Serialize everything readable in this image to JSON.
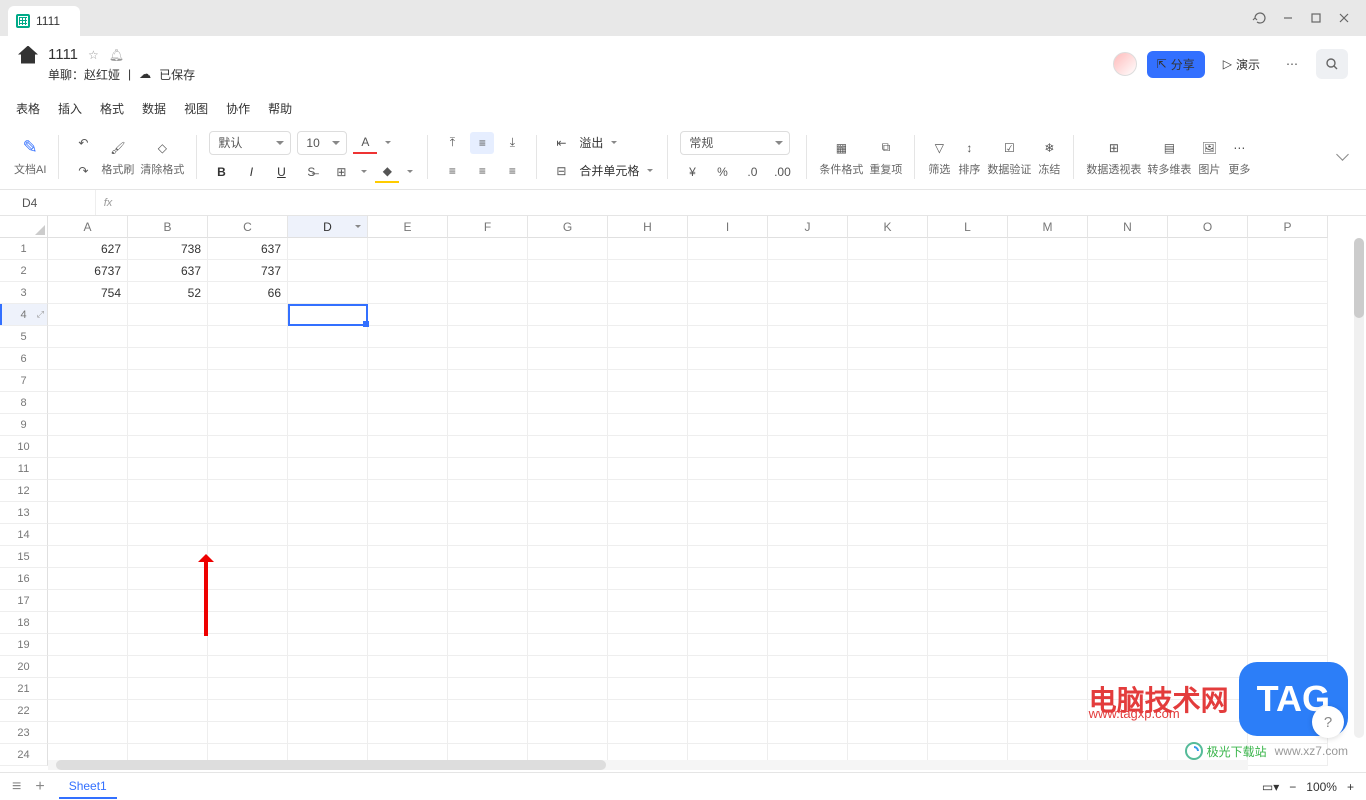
{
  "titlebar": {
    "tab": "1111"
  },
  "header": {
    "title": "1111",
    "author_label": "单聊：",
    "author": "赵红娅",
    "saved_label": "已保存",
    "share": "分享",
    "present": "演示"
  },
  "menu": [
    "表格",
    "插入",
    "格式",
    "数据",
    "视图",
    "协作",
    "帮助"
  ],
  "toolbar": {
    "doc_ai": "文档AI",
    "brush": "格式刷",
    "clear": "清除格式",
    "font": "默认",
    "size": "10",
    "overflow": "溢出",
    "merge": "合并单元格",
    "format": "常规",
    "cond": "条件格式",
    "dup": "重复项",
    "filter": "筛选",
    "sort": "排序",
    "valid": "数据验证",
    "freeze": "冻结",
    "pivot": "数据透视表",
    "convert": "转多维表",
    "image": "图片",
    "more": "更多"
  },
  "cell_ref": "D4",
  "columns": [
    "A",
    "B",
    "C",
    "D",
    "E",
    "F",
    "G",
    "H",
    "I",
    "J",
    "K",
    "L",
    "M",
    "N",
    "O",
    "P"
  ],
  "rows": [
    "1",
    "2",
    "3",
    "4",
    "5",
    "6",
    "7",
    "8",
    "9",
    "10",
    "11",
    "12",
    "13",
    "14",
    "15",
    "16",
    "17",
    "18",
    "19",
    "20",
    "21",
    "22",
    "23",
    "24"
  ],
  "data": {
    "r1": {
      "A": "627",
      "B": "738",
      "C": "637"
    },
    "r2": {
      "A": "6737",
      "B": "637",
      "C": "737"
    },
    "r3": {
      "A": "754",
      "B": "52",
      "C": "66"
    }
  },
  "status": {
    "sheet": "Sheet1",
    "zoom": "100%"
  },
  "watermark": {
    "text": "电脑技术网",
    "url": "www.tagxp.com",
    "tag": "TAG",
    "site": "极光下载站",
    "site_url": "www.xz7.com"
  }
}
